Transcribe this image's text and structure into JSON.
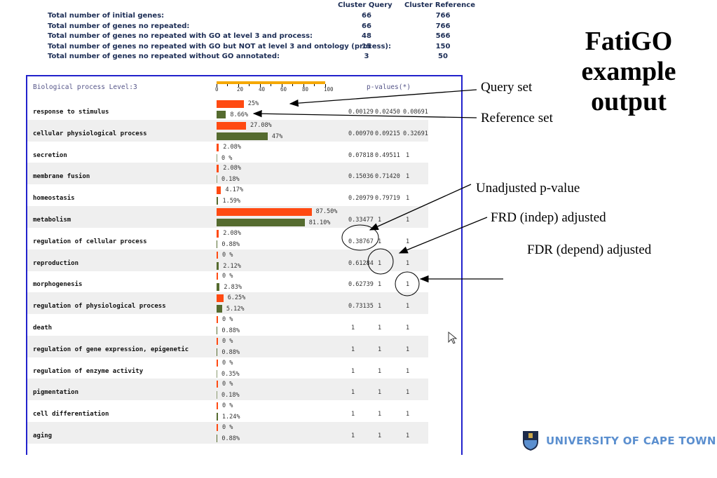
{
  "stats": {
    "headers": [
      "Cluster Query",
      "Cluster Reference"
    ],
    "rows": [
      {
        "label": "Total number of initial genes:",
        "query": "66",
        "reference": "766"
      },
      {
        "label": "Total number of genes no repeated:",
        "query": "66",
        "reference": "766"
      },
      {
        "label": "Total number of genes no repeated with GO at level 3 and process:",
        "query": "48",
        "reference": "566"
      },
      {
        "label": "Total number of genes no repeated with GO but NOT at level 3 and ontology (process):",
        "query": "15",
        "reference": "150"
      },
      {
        "label": "Total number of genes no repeated without GO annotated:",
        "query": "3",
        "reference": "50"
      }
    ]
  },
  "panel": {
    "title": "Biological process Level:3",
    "pvalues_header": "p-values(*)",
    "scale_ticks": [
      "0",
      "20",
      "40",
      "60",
      "80",
      "100"
    ],
    "colors": {
      "query": "#ff4a12",
      "reference": "#556b2f",
      "scale": "#f5a800"
    }
  },
  "chart_data": {
    "type": "bar",
    "categories": [
      "response to stimulus",
      "cellular physiological process",
      "secretion",
      "membrane fusion",
      "homeostasis",
      "metabolism",
      "regulation of cellular process",
      "reproduction",
      "morphogenesis",
      "regulation of physiological process",
      "death",
      "regulation of gene expression, epigenetic",
      "regulation of enzyme activity",
      "pigmentation",
      "cell differentiation",
      "aging"
    ],
    "series": [
      {
        "name": "Query set",
        "values": [
          25,
          27.08,
          2.08,
          2.08,
          4.17,
          87.5,
          2.08,
          0,
          0,
          6.25,
          0,
          0,
          0,
          0,
          0,
          0
        ],
        "labels": [
          "25%",
          "27.08%",
          "2.08%",
          "2.08%",
          "4.17%",
          "87.50%",
          "2.08%",
          "0 %",
          "0 %",
          "6.25%",
          "0 %",
          "0 %",
          "0 %",
          "0 %",
          "0 %",
          "0 %"
        ]
      },
      {
        "name": "Reference set",
        "values": [
          8.66,
          47,
          0,
          0.18,
          1.59,
          81.1,
          0.88,
          2.12,
          2.83,
          5.12,
          0.88,
          0.88,
          0.35,
          0.18,
          1.24,
          0.88
        ],
        "labels": [
          "8.66%",
          "47%",
          "0 %",
          "0.18%",
          "1.59%",
          "81.10%",
          "0.88%",
          "2.12%",
          "2.83%",
          "5.12%",
          "0.88%",
          "0.88%",
          "0.35%",
          "0.18%",
          "1.24%",
          "0.88%"
        ]
      }
    ],
    "pvalues": [
      [
        "0.00129",
        "0.02450",
        "0.08691"
      ],
      [
        "0.00970",
        "0.09215",
        "0.32691"
      ],
      [
        "0.07818",
        "0.49511",
        "1"
      ],
      [
        "0.15036",
        "0.71420",
        "1"
      ],
      [
        "0.20979",
        "0.79719",
        "1"
      ],
      [
        "0.33477",
        "1",
        "1"
      ],
      [
        "0.38767",
        "1",
        "1"
      ],
      [
        "0.61284",
        "1",
        "1"
      ],
      [
        "0.62739",
        "1",
        "1"
      ],
      [
        "0.73135",
        "1",
        "1"
      ],
      [
        "1",
        "1",
        "1"
      ],
      [
        "1",
        "1",
        "1"
      ],
      [
        "1",
        "1",
        "1"
      ],
      [
        "1",
        "1",
        "1"
      ],
      [
        "1",
        "1",
        "1"
      ],
      [
        "1",
        "1",
        "1"
      ]
    ],
    "xlim": [
      0,
      100
    ]
  },
  "annotations": {
    "query_set": "Query set",
    "reference_set": "Reference set",
    "unadjusted": "Unadjusted p-value",
    "frd": "FRD (indep) adjusted",
    "fdr": "FDR (depend) adjusted"
  },
  "slide_title": [
    "FatiGO",
    "example",
    "output"
  ],
  "logo_text": "UNIVERSITY OF CAPE TOWN"
}
